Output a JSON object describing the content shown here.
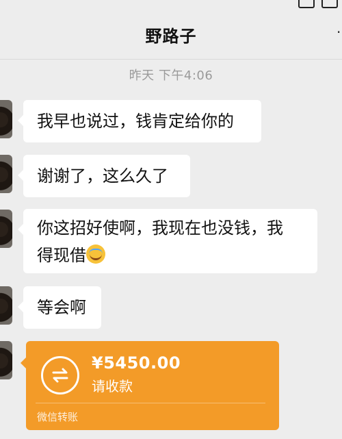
{
  "header": {
    "title": "野路子"
  },
  "chat": {
    "timestamp": "昨天 下午4:06",
    "messages": [
      {
        "text": "我早也说过，钱肯定给你的"
      },
      {
        "text": "谢谢了，这么久了"
      },
      {
        "text_line1": "你这招好使啊，我现在也没钱，我",
        "text_line2": "得现借"
      },
      {
        "text": "等会啊"
      }
    ],
    "transfer": {
      "amount": "¥5450.00",
      "status": "请收款",
      "label": "微信转账",
      "color": "#f39b28"
    }
  },
  "icons": {
    "transfer": "transfer-arrows-icon",
    "more": "more-icon",
    "emoji": "laughing-tears-emoji"
  }
}
